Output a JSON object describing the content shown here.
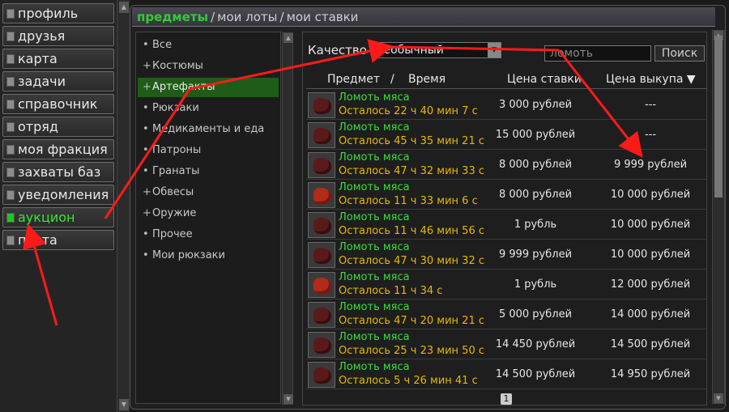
{
  "nav": {
    "items": [
      {
        "label": "профиль"
      },
      {
        "label": "друзья"
      },
      {
        "label": "карта"
      },
      {
        "label": "задачи"
      },
      {
        "label": "справочник"
      },
      {
        "label": "отряд"
      },
      {
        "label": "моя фракция"
      },
      {
        "label": "захваты баз"
      },
      {
        "label": "уведомления"
      },
      {
        "label": "аукцион"
      },
      {
        "label": "почта"
      }
    ],
    "active_index": 9
  },
  "tabs": {
    "items": [
      "предметы",
      "мои лоты",
      "мои ставки"
    ],
    "separator": "/"
  },
  "categories": [
    {
      "marker": "•",
      "label": "Все"
    },
    {
      "marker": "+",
      "label": "Костюмы"
    },
    {
      "marker": "+",
      "label": "Артефакты"
    },
    {
      "marker": "•",
      "label": "Рюкзаки"
    },
    {
      "marker": "•",
      "label": "Медикаменты и еда"
    },
    {
      "marker": "•",
      "label": "Патроны"
    },
    {
      "marker": "•",
      "label": "Гранаты"
    },
    {
      "marker": "+",
      "label": "Обвесы"
    },
    {
      "marker": "+",
      "label": "Оружие"
    },
    {
      "marker": "•",
      "label": "Прочее"
    },
    {
      "marker": "•",
      "label": "Мои рюкзаки"
    }
  ],
  "filter": {
    "quality_label": "Качество",
    "quality_value": "Необычный",
    "search_value": "ломоть",
    "search_button": "Поиск"
  },
  "table": {
    "headers": {
      "item": "Предмет",
      "slash": "/",
      "time": "Время",
      "bid": "Цена ставки",
      "buyout": "Цена выкупа ▼"
    },
    "rows": [
      {
        "name": "Ломоть мяса",
        "time": "Осталось 22 ч 40 мин 7 с",
        "bid": "3 000 рублей",
        "buyout": "---",
        "bright": false
      },
      {
        "name": "Ломоть мяса",
        "time": "Осталось 45 ч 35 мин 21 с",
        "bid": "15 000 рублей",
        "buyout": "---",
        "bright": false
      },
      {
        "name": "Ломоть мяса",
        "time": "Осталось 47 ч 32 мин 33 с",
        "bid": "8 000 рублей",
        "buyout": "9 999 рублей",
        "bright": false
      },
      {
        "name": "Ломоть мяса",
        "time": "Осталось 11 ч 33 мин 6 с",
        "bid": "8 000 рублей",
        "buyout": "10 000 рублей",
        "bright": true
      },
      {
        "name": "Ломоть мяса",
        "time": "Осталось 11 ч 46 мин 56 с",
        "bid": "1 рубль",
        "buyout": "10 000 рублей",
        "bright": false
      },
      {
        "name": "Ломоть мяса",
        "time": "Осталось 47 ч 30 мин 32 с",
        "bid": "9 999 рублей",
        "buyout": "10 000 рублей",
        "bright": false
      },
      {
        "name": "Ломоть мяса",
        "time": "Осталось 11 ч 34 с",
        "bid": "1 рубль",
        "buyout": "12 000 рублей",
        "bright": true
      },
      {
        "name": "Ломоть мяса",
        "time": "Осталось 47 ч 20 мин 21 с",
        "bid": "5 000 рублей",
        "buyout": "14 000 рублей",
        "bright": false
      },
      {
        "name": "Ломоть мяса",
        "time": "Осталось 25 ч 23 мин 50 с",
        "bid": "14 450 рублей",
        "buyout": "14 500 рублей",
        "bright": false
      },
      {
        "name": "Ломоть мяса",
        "time": "Осталось 5 ч 26 мин 41 с",
        "bid": "14 500 рублей",
        "buyout": "14 950 рублей",
        "bright": false
      }
    ]
  },
  "pager": {
    "current": "1"
  },
  "colors": {
    "accent_green": "#2bd12b",
    "time_yellow": "#e6b800",
    "annotation_red": "#ff1a1a"
  }
}
